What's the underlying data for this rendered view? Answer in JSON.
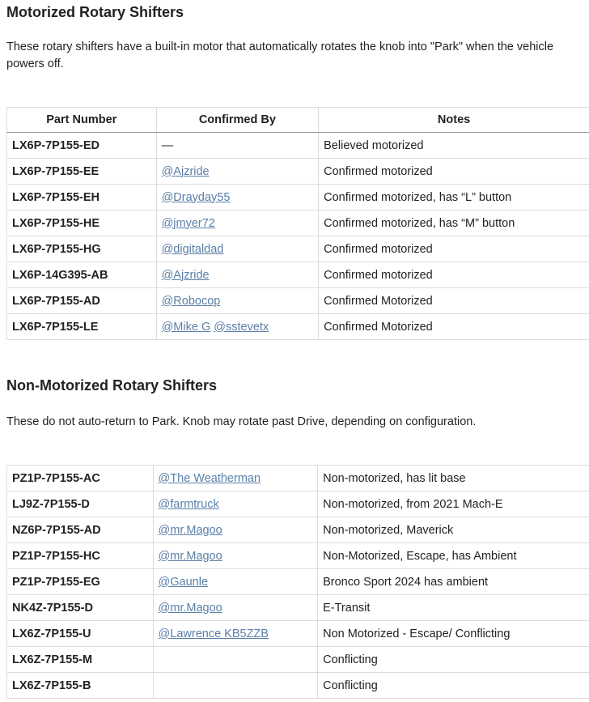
{
  "motorized": {
    "title": "Motorized Rotary Shifters",
    "description": "These rotary shifters have a built-in motor that automatically rotates the knob into \"Park\" when the vehicle powers off.",
    "headers": [
      "Part Number",
      "Confirmed By",
      "Notes"
    ],
    "rows": [
      {
        "part": "LX6P-7P155-ED",
        "users": [],
        "dash": "—",
        "notes": "Believed motorized"
      },
      {
        "part": "LX6P-7P155-EE",
        "users": [
          "@Ajzride"
        ],
        "notes": "Confirmed motorized"
      },
      {
        "part": "LX6P-7P155-EH",
        "users": [
          "@Drayday55"
        ],
        "notes": "Confirmed motorized, has “L” button"
      },
      {
        "part": "LX6P-7P155-HE",
        "users": [
          "@jmyer72"
        ],
        "notes": "Confirmed motorized, has “M” button"
      },
      {
        "part": "LX6P-7P155-HG",
        "users": [
          "@digitaldad"
        ],
        "notes": "Confirmed motorized"
      },
      {
        "part": "LX6P-14G395-AB",
        "users": [
          "@Ajzride"
        ],
        "notes": "Confirmed motorized"
      },
      {
        "part": "LX6P-7P155-AD",
        "users": [
          "@Robocop"
        ],
        "notes": "Confirmed Motorized"
      },
      {
        "part": "LX6P-7P155-LE",
        "users": [
          "@Mike G",
          "@sstevetx"
        ],
        "notes": "Confirmed Motorized"
      }
    ]
  },
  "non_motorized": {
    "title": "Non-Motorized Rotary Shifters",
    "description": "These do not auto-return to Park. Knob may rotate past Drive, depending on configuration.",
    "rows": [
      {
        "part": "PZ1P-7P155-AC",
        "users": [
          "@The Weatherman"
        ],
        "notes": "Non-motorized, has lit base"
      },
      {
        "part": "LJ9Z-7P155-D",
        "users": [
          "@farmtruck"
        ],
        "notes": "Non-motorized, from 2021 Mach-E"
      },
      {
        "part": "NZ6P-7P155-AD",
        "users": [
          "@mr.Magoo"
        ],
        "notes": "Non-motorized, Maverick"
      },
      {
        "part": "PZ1P-7P155-HC",
        "users": [
          "@mr.Magoo"
        ],
        "notes": "Non-Motorized, Escape, has Ambient"
      },
      {
        "part": "PZ1P-7P155-EG",
        "users": [
          "@Gaunle"
        ],
        "notes": "Bronco Sport 2024 has ambient"
      },
      {
        "part": "NK4Z-7P155-D",
        "users": [
          "@mr.Magoo"
        ],
        "notes": "E-Transit"
      },
      {
        "part": "LX6Z-7P155-U",
        "users": [
          "@Lawrence KB5ZZB"
        ],
        "notes": "Non Motorized - Escape/ Conflicting"
      },
      {
        "part": "LX6Z-7P155-M",
        "users": [],
        "notes": "Conflicting"
      },
      {
        "part": "LX6Z-7P155-B",
        "users": [],
        "notes": "Conflicting"
      }
    ]
  },
  "colors": {
    "link": "#5a7fa8",
    "border": "#dcdcdc",
    "text": "#222222"
  }
}
